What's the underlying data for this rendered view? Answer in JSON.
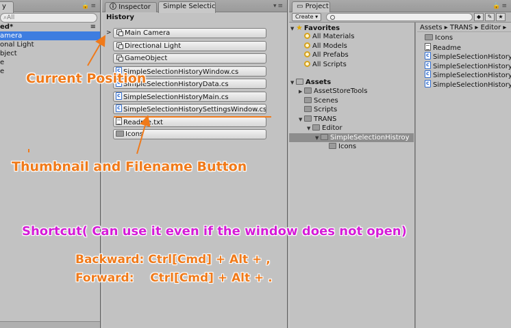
{
  "hierarchy": {
    "tab_label": "y",
    "search_placeholder": "All",
    "scene_header": "ed*",
    "items": [
      {
        "label": "amera",
        "selected": true
      },
      {
        "label": "onal Light",
        "selected": false
      },
      {
        "label": "bject",
        "selected": false
      },
      {
        "label": "e",
        "selected": false
      },
      {
        "label": "e",
        "selected": false
      }
    ]
  },
  "inspector": {
    "tabs": [
      {
        "label": "Inspector",
        "active": false
      },
      {
        "label": "Simple Selectic",
        "active": true
      }
    ],
    "history_title": "History",
    "current_marker": ">",
    "history_buttons": [
      {
        "label": "Main Camera",
        "icon": "gameobject-icon"
      },
      {
        "label": "Directional Light",
        "icon": "gameobject-icon"
      },
      {
        "label": "GameObject",
        "icon": "gameobject-icon"
      },
      {
        "label": "SimpleSelectionHistoryWindow.cs",
        "icon": "csharp-script-icon"
      },
      {
        "label": "SimpleSelectionHistoryData.cs",
        "icon": "csharp-script-icon"
      },
      {
        "label": "SimpleSelectionHistoryMain.cs",
        "icon": "csharp-script-icon"
      },
      {
        "label": "SimpleSelectionHistorySettingsWindow.cs",
        "icon": "csharp-script-icon"
      },
      {
        "label": "Readme.txt",
        "icon": "text-file-icon"
      },
      {
        "label": "Icons",
        "icon": "folder-icon"
      }
    ]
  },
  "annotations": {
    "current_position": "Current Position",
    "thumbnail_button": "Thumbnail and Filename Button",
    "shortcut": "Shortcut( Can use it even if the window does not open)",
    "backward": "Backward: Ctrl[Cmd] + Alt + ,",
    "forward": "Forward:    Ctrl[Cmd] + Alt + ."
  },
  "project": {
    "tab_label": "Project",
    "create_label": "Create ▾",
    "favorites": {
      "label": "Favorites",
      "items": [
        "All Materials",
        "All Models",
        "All Prefabs",
        "All Scripts"
      ]
    },
    "assets": {
      "label": "Assets",
      "items": [
        {
          "label": "AssetStoreTools",
          "depth": 1,
          "selected": false
        },
        {
          "label": "Scenes",
          "depth": 1,
          "selected": false
        },
        {
          "label": "Scripts",
          "depth": 1,
          "selected": false
        },
        {
          "label": "TRANS",
          "depth": 1,
          "selected": false
        },
        {
          "label": "Editor",
          "depth": 2,
          "selected": false
        },
        {
          "label": "SimpleSelectionHistroy",
          "depth": 3,
          "selected": true
        },
        {
          "label": "Icons",
          "depth": 4,
          "selected": false
        }
      ]
    },
    "breadcrumb": "Assets ▸ TRANS ▸ Editor ▸",
    "files": [
      {
        "label": "Icons",
        "icon": "folder-icon"
      },
      {
        "label": "Readme",
        "icon": "text-file-icon"
      },
      {
        "label": "SimpleSelectionHistoryD",
        "icon": "csharp-script-icon"
      },
      {
        "label": "SimpleSelectionHistoryM",
        "icon": "csharp-script-icon"
      },
      {
        "label": "SimpleSelectionHistoryS",
        "icon": "csharp-script-icon"
      },
      {
        "label": "SimpleSelectionHistoryW",
        "icon": "csharp-script-icon"
      }
    ]
  },
  "colors": {
    "annotation_orange": "#f07a1a",
    "annotation_magenta": "#d51bd8",
    "selection_blue": "#3e7de0"
  }
}
